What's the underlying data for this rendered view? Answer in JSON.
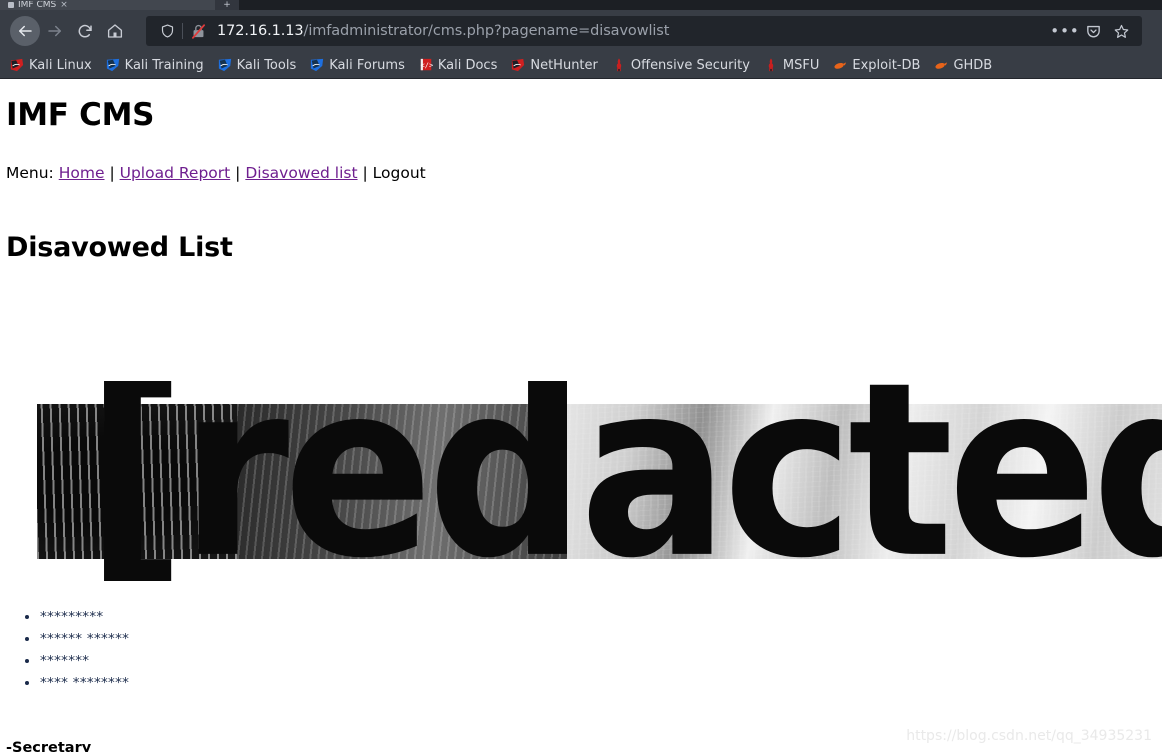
{
  "browser": {
    "tab": {
      "title": "IMF CMS",
      "favicon": "page-icon",
      "close_label": "×"
    },
    "new_tab_label": "+",
    "nav": {
      "back": "back-arrow",
      "forward": "forward-arrow",
      "reload": "reload-arrow",
      "home": "home-house"
    },
    "urlbar": {
      "shield_icon": "tracking-protection-shield",
      "insecure_icon": "insecure-connection-crossed-lock",
      "host": "172.16.1.13",
      "path": "/imfadministrator/cms.php?pagename=disavowlist",
      "full_url": "172.16.1.13/imfadministrator/cms.php?pagename=disavowlist",
      "menu_label": "•••",
      "pocket_icon": "pocket-icon",
      "bookmark_icon": "star-icon"
    },
    "bookmarks": [
      {
        "label": "Kali Linux",
        "icon": "kali-dragon-red"
      },
      {
        "label": "Kali Training",
        "icon": "kali-dragon-blue"
      },
      {
        "label": "Kali Tools",
        "icon": "kali-dragon-blue"
      },
      {
        "label": "Kali Forums",
        "icon": "kali-dragon-blue"
      },
      {
        "label": "Kali Docs",
        "icon": "kali-docs-book-red"
      },
      {
        "label": "NetHunter",
        "icon": "kali-dragon-red"
      },
      {
        "label": "Offensive Security",
        "icon": "offsec-dragon-red"
      },
      {
        "label": "MSFU",
        "icon": "offsec-dragon-red"
      },
      {
        "label": "Exploit-DB",
        "icon": "exploitdb-flame-orange"
      },
      {
        "label": "GHDB",
        "icon": "ghdb-flame-orange"
      }
    ]
  },
  "page": {
    "title": "IMF CMS",
    "menu": {
      "prefix": "Menu:",
      "items": [
        {
          "label": "Home",
          "link": true
        },
        {
          "label": "Upload Report",
          "link": true
        },
        {
          "label": "Disavowed list",
          "link": true
        },
        {
          "label": "Logout",
          "link": false
        }
      ],
      "separator": "|"
    },
    "section_title": "Disavowed List",
    "image": {
      "alt": "redacted",
      "stamp_text": "[redacted]"
    },
    "list_items": [
      "*********",
      "****** ******",
      "*******",
      "**** ********"
    ],
    "signature": "-Secretary",
    "watermark": "https://blog.csdn.net/qq_34935231"
  },
  "colors": {
    "chrome_bg": "#383d45",
    "urlbar_bg": "#21252b",
    "link": "#6f1f8f",
    "text": "#000000",
    "list_text": "#1a2a4a",
    "watermark": "#e9e9e9"
  }
}
